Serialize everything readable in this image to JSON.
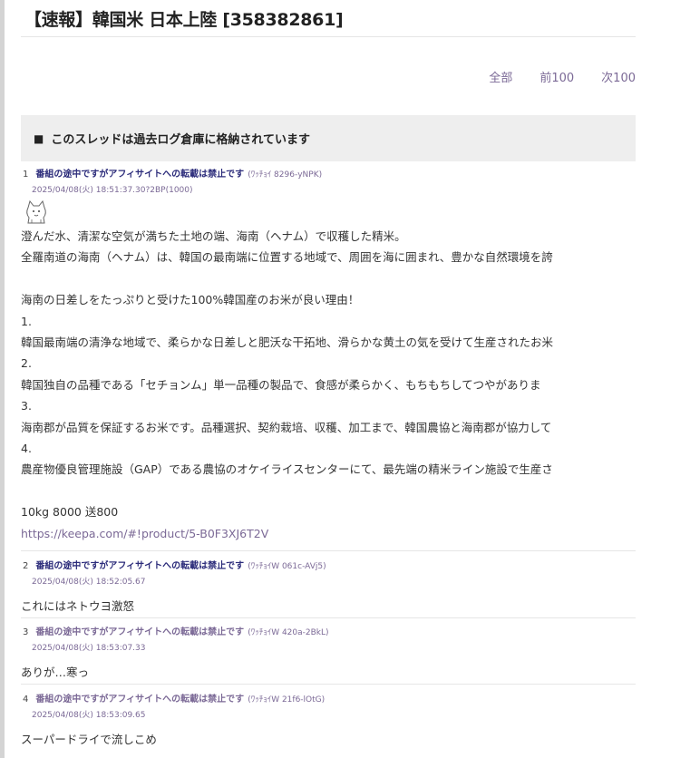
{
  "thread": {
    "title": "【速報】韓国米 日本上陸 [358382861]"
  },
  "pager": {
    "all": "全部",
    "prev": "前100",
    "next": "次100"
  },
  "archived_notice": {
    "marker": "■",
    "text": "このスレッドは過去ログ倉庫に格納されています"
  },
  "posts": [
    {
      "number": "1",
      "name": "番組の途中ですがアフィサイトへの転載は禁止です",
      "id": "(ﾜｯﾁｮｲ 8296-yNPK)",
      "date": "2025/04/08(火) 18:51:37.30?2BP(1000)",
      "icon": "be-cat-icon",
      "lines": [
        "澄んだ水、清潔な空気が満ちた土地の端、海南（ヘナム）で収穫した精米。",
        "全羅南道の海南（ヘナム）は、韓国の最南端に位置する地域で、周囲を海に囲まれ、豊かな自然環境を誇",
        "",
        "海南の日差しをたっぷりと受けた100%韓国産のお米が良い理由！",
        "1.",
        "韓国最南端の清浄な地域で、柔らかな日差しと肥沃な干拓地、滑らかな黄土の気を受けて生産されたお米",
        "2.",
        "韓国独自の品種である「セチョンム」単一品種の製品で、食感が柔らかく、もちもちしてつやがありま",
        "3.",
        "海南郡が品質を保証するお米です。品種選択、契約栽培、収穫、加工まで、韓国農協と海南郡が協力して",
        "4.",
        "農産物優良管理施設（GAP）である農協のオケイライスセンターにて、最先端の精米ライン施設で生産さ",
        "",
        "10kg 8000 送800"
      ],
      "link": "https://keepa.com/#!product/5-B0F3XJ6T2V"
    },
    {
      "number": "2",
      "name": "番組の途中ですがアフィサイトへの転載は禁止です",
      "id": "(ﾜｯﾁｮｲW 061c-AVj5)",
      "date": "2025/04/08(火) 18:52:05.67",
      "lines": [
        "これにはネトウヨ激怒"
      ]
    },
    {
      "number": "3",
      "name": "番組の途中ですがアフィサイトへの転載は禁止です",
      "id": "(ﾜｯﾁｮｲW 420a-2BkL)",
      "date": "2025/04/08(火) 18:53:07.33",
      "lines": [
        "ありが…寒っ"
      ]
    },
    {
      "number": "4",
      "name": "番組の途中ですがアフィサイトへの転載は禁止です",
      "id": "(ﾜｯﾁｮｲW 21f6-lOtG)",
      "date": "2025/04/08(火) 18:53:09.65",
      "lines": [
        "スーパードライで流しこめ"
      ]
    }
  ]
}
